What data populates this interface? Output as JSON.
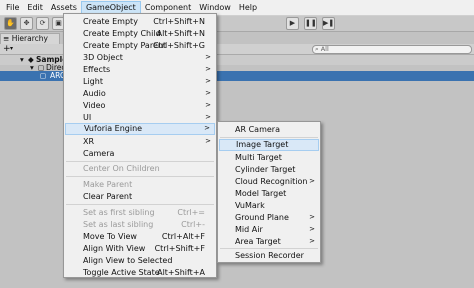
{
  "menubar": [
    "File",
    "Edit",
    "Assets",
    "GameObject",
    "Component",
    "Window",
    "Help"
  ],
  "toolbar": {
    "tools": [
      "hand-tool-icon",
      "move-tool-icon",
      "rotate-tool-icon"
    ],
    "play": "play-icon",
    "pause": "pause-icon",
    "step": "step-icon"
  },
  "hierarchy": {
    "tab": "Hierarchy",
    "add": "+",
    "search_placeholder": "All",
    "rows": [
      "SampleS",
      "Directi",
      "ARC"
    ]
  },
  "gameobject_menu": [
    {
      "label": "Create Empty",
      "shortcut": "Ctrl+Shift+N"
    },
    {
      "label": "Create Empty Child",
      "shortcut": "Alt+Shift+N"
    },
    {
      "label": "Create Empty Parent",
      "shortcut": "Ctrl+Shift+G"
    },
    {
      "label": "3D Object",
      "shortcut": ">"
    },
    {
      "label": "Effects",
      "shortcut": ">"
    },
    {
      "label": "Light",
      "shortcut": ">"
    },
    {
      "label": "Audio",
      "shortcut": ">"
    },
    {
      "label": "Video",
      "shortcut": ">"
    },
    {
      "label": "UI",
      "shortcut": ">"
    },
    {
      "label": "Vuforia Engine",
      "shortcut": ">"
    },
    {
      "label": "XR",
      "shortcut": ">"
    },
    {
      "label": "Camera",
      "shortcut": ""
    },
    {
      "label": "Center On Children",
      "shortcut": ""
    },
    {
      "label": "Make Parent",
      "shortcut": ""
    },
    {
      "label": "Clear Parent",
      "shortcut": ""
    },
    {
      "label": "Set as first sibling",
      "shortcut": "Ctrl+="
    },
    {
      "label": "Set as last sibling",
      "shortcut": "Ctrl+-"
    },
    {
      "label": "Move To View",
      "shortcut": "Ctrl+Alt+F"
    },
    {
      "label": "Align With View",
      "shortcut": "Ctrl+Shift+F"
    },
    {
      "label": "Align View to Selected",
      "shortcut": ""
    },
    {
      "label": "Toggle Active State",
      "shortcut": "Alt+Shift+A"
    }
  ],
  "vuforia_menu": [
    {
      "label": "AR Camera",
      "arrow": ""
    },
    {
      "label": "Image Target",
      "arrow": ""
    },
    {
      "label": "Multi Target",
      "arrow": ""
    },
    {
      "label": "Cylinder Target",
      "arrow": ""
    },
    {
      "label": "Cloud Recognition",
      "arrow": ">"
    },
    {
      "label": "Model Target",
      "arrow": ""
    },
    {
      "label": "VuMark",
      "arrow": ""
    },
    {
      "label": "Ground Plane",
      "arrow": ">"
    },
    {
      "label": "Mid Air",
      "arrow": ">"
    },
    {
      "label": "Area Target",
      "arrow": ">"
    },
    {
      "label": "Session Recorder",
      "arrow": ""
    }
  ]
}
